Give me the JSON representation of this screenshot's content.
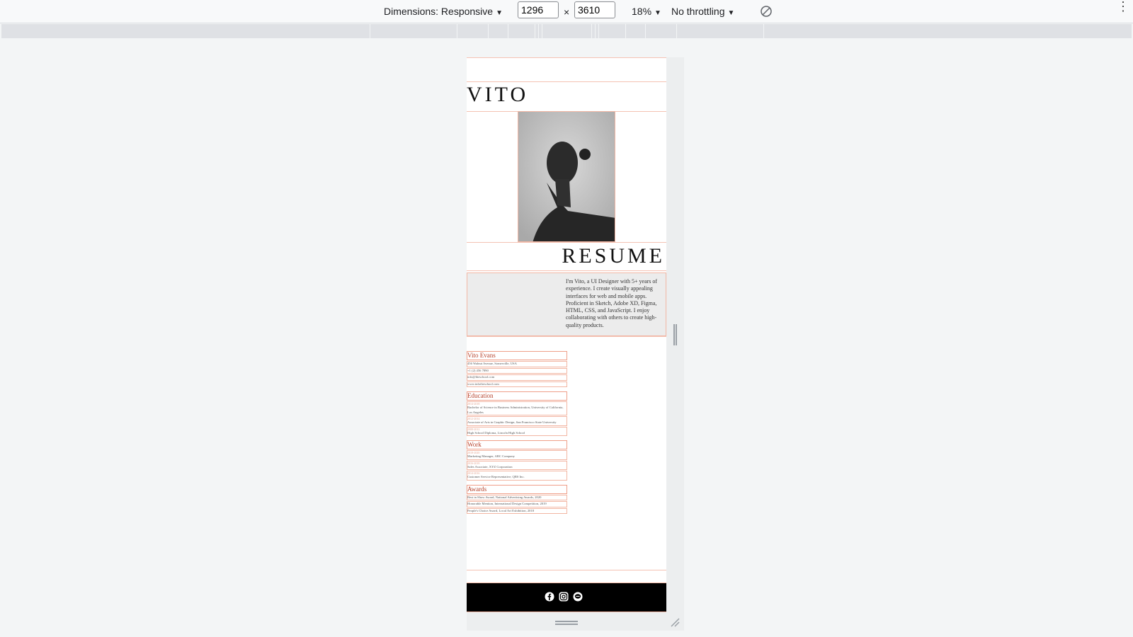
{
  "toolbar": {
    "dimensions_label": "Dimensions: Responsive",
    "width_value": "1296",
    "times": "×",
    "height_value": "3610",
    "zoom": "18%",
    "throttling": "No throttling"
  },
  "page": {
    "brand": "VITO",
    "resume_title": "RESUME",
    "intro": "I'm Vito, a UI Designer with 5+ years of experience. I create visually appealing interfaces for web and mobile apps. Proficient in Sketch, Adobe XD, Figma, HTML, CSS, and JavaScript. I enjoy collaborating with others to create high-quality products.",
    "contact": {
      "name": "Vito Evans",
      "address": "456 Walnut Avenue, Somerville, USA",
      "phone": "+1 (2) 456 7890",
      "email": "info@theschool.com",
      "website": "www.infotheschool.com"
    },
    "education": {
      "heading": "Education",
      "items": [
        {
          "date": "2014-2018",
          "text": "Bachelor of Science in Business Administration, University of California, Los Angeles"
        },
        {
          "date": "2012-2014",
          "text": "Associate of Arts in Graphic Design, San Francisco State University"
        },
        {
          "date": "2008-2012",
          "text": "High School Diploma, Lincoln High School"
        }
      ]
    },
    "work": {
      "heading": "Work",
      "items": [
        {
          "date": "2018-2020",
          "text": "Marketing Manager, ABC Company"
        },
        {
          "date": "2016-2018",
          "text": "Sales Associate, XYZ Corporation"
        },
        {
          "date": "2014-2016",
          "text": "Customer Service Representative, QRS Inc."
        }
      ]
    },
    "awards": {
      "heading": "Awards",
      "items": [
        "Best in Show Award, National Advertising Awards, 2020",
        "Honorable Mention, International Design Competition, 2019",
        "People's Choice Award, Local Art Exhibition, 2018"
      ]
    },
    "social_icons": [
      "facebook-icon",
      "instagram-icon",
      "line-icon"
    ]
  },
  "colors": {
    "accent": "#b5402a",
    "outline": "#f2b6a3",
    "footer_bg": "#000000"
  }
}
